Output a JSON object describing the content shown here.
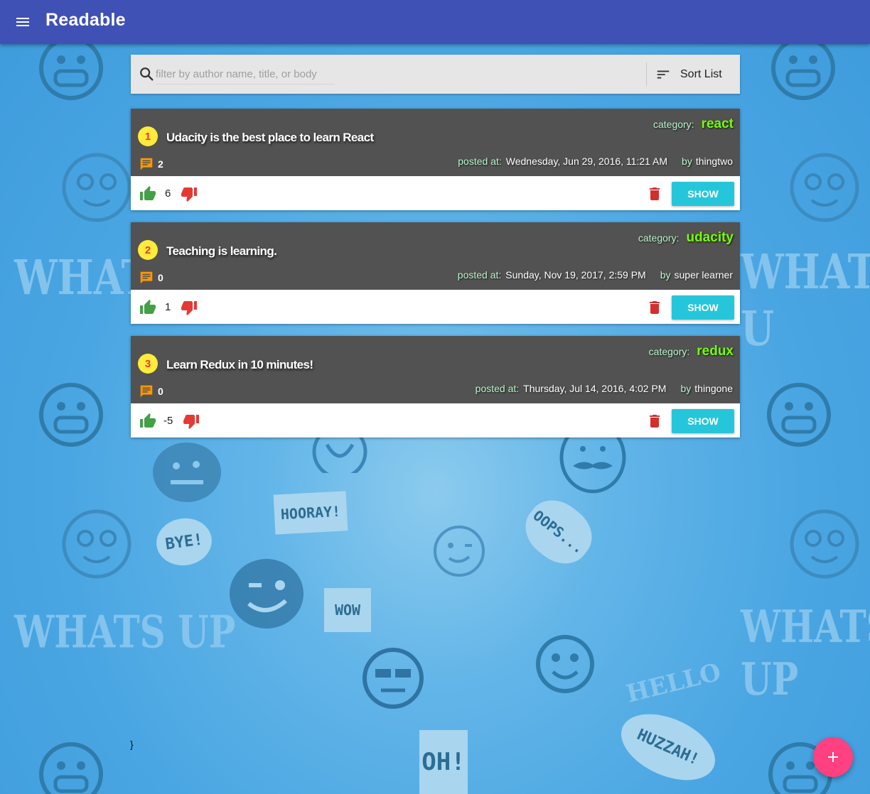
{
  "appbar": {
    "title": "Readable",
    "menu_icon": "menu-icon"
  },
  "search": {
    "placeholder": "filter by author name, title, or body",
    "value": "",
    "icon": "search-icon"
  },
  "sort": {
    "label": "Sort List",
    "icon": "sort-icon"
  },
  "labels": {
    "category": "category:",
    "posted_at": "posted at:",
    "by": "by",
    "show": "SHOW"
  },
  "posts": [
    {
      "rank": "1",
      "title": "Udacity is the best place to learn React",
      "category": "react",
      "comments": "2",
      "posted_at": "Wednesday, Jun 29, 2016, 11:21 AM",
      "author": "thingtwo",
      "score": "6"
    },
    {
      "rank": "2",
      "title": "Teaching is learning.",
      "category": "udacity",
      "comments": "0",
      "posted_at": "Sunday, Nov 19, 2017, 2:59 PM",
      "author": "super learner",
      "score": "1"
    },
    {
      "rank": "3",
      "title": "Learn Redux in 10 minutes!",
      "category": "redux",
      "comments": "0",
      "posted_at": "Thursday, Jul 14, 2016, 4:02 PM",
      "author": "thingone",
      "score": "-5"
    }
  ],
  "stray_text": "}",
  "background": {
    "words": [
      "WHATS",
      "WHATS UP",
      "WHATS UP",
      "HELLO",
      "WHATS U"
    ],
    "bubbles": [
      "HOORAY!",
      "BYE!",
      "WOW",
      "OOPS...",
      "HUZZAH!",
      "OH!"
    ]
  },
  "colors": {
    "appbar": "#3f51b5",
    "card_header": "#525252",
    "category_label": "#b9f6ca",
    "category_value": "#76ff03",
    "rank_badge": "#ffeb3b",
    "rank_text": "#e53935",
    "comment_icon": "#ff9800",
    "thumb_up": "#43a047",
    "thumb_down": "#e53935",
    "delete": "#d32f2f",
    "show_button": "#26c6da",
    "fab": "#ff4081"
  },
  "fab": {
    "icon": "plus-icon"
  }
}
